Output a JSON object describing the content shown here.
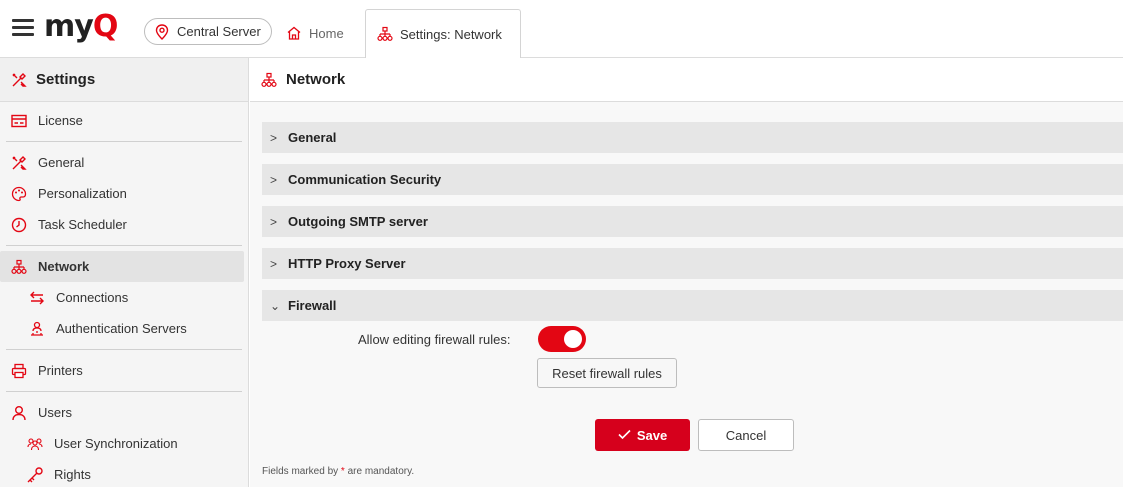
{
  "app": {
    "logo_text": "my",
    "logo_q": "Q",
    "accent": "#e30613"
  },
  "topbar": {
    "server_label": "Central Server",
    "home_tab": "Home",
    "active_tab": "Settings: Network"
  },
  "sidebar": {
    "title": "Settings",
    "items": {
      "license": "License",
      "general": "General",
      "personalization": "Personalization",
      "task_scheduler": "Task Scheduler",
      "network": "Network",
      "connections": "Connections",
      "auth_servers": "Authentication Servers",
      "printers": "Printers",
      "users": "Users",
      "user_sync": "User Synchronization",
      "rights": "Rights"
    }
  },
  "main": {
    "title": "Network",
    "sections": {
      "general": "General",
      "comm_security": "Communication Security",
      "smtp": "Outgoing SMTP server",
      "http_proxy": "HTTP Proxy Server",
      "firewall": "Firewall"
    },
    "firewall": {
      "allow_label": "Allow editing firewall rules:",
      "allow_enabled": true,
      "reset_label": "Reset firewall rules"
    },
    "save_label": "Save",
    "cancel_label": "Cancel",
    "footnote_prefix": "Fields marked by ",
    "footnote_star": "*",
    "footnote_suffix": " are mandatory."
  }
}
